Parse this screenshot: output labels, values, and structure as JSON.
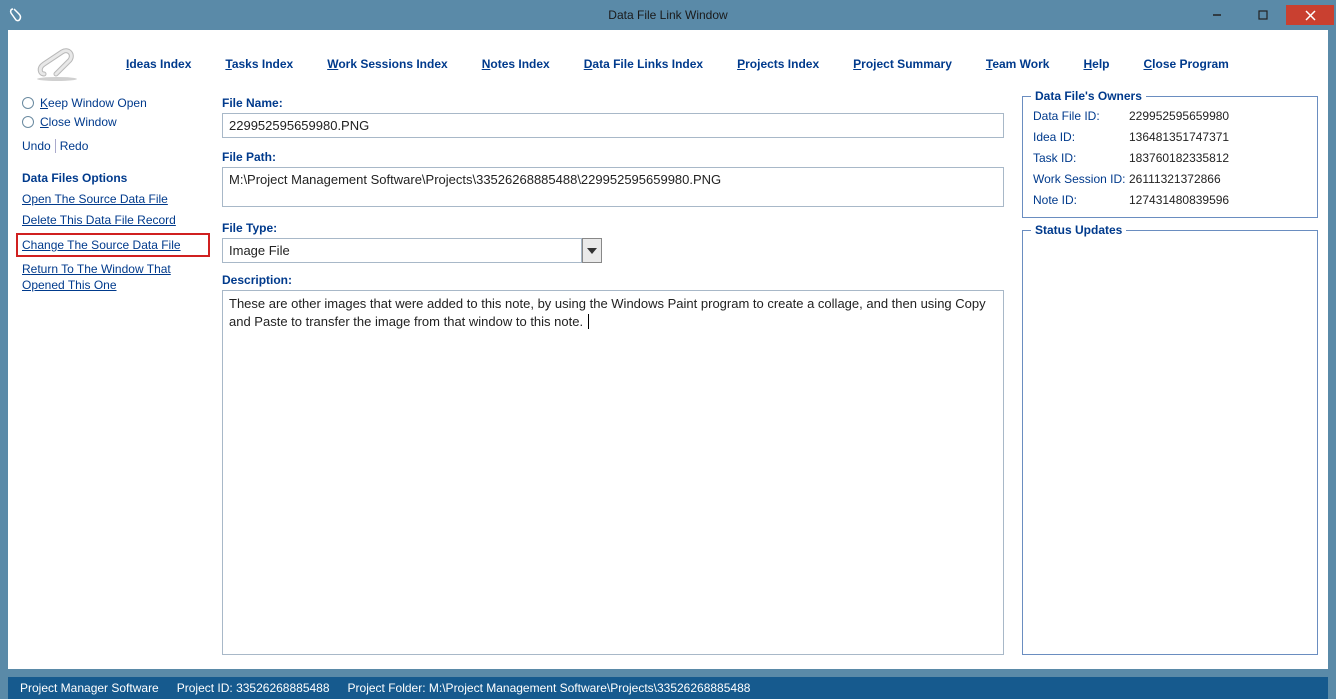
{
  "window": {
    "title": "Data File Link Window"
  },
  "menu": {
    "ideas": "deas Index",
    "tasks": "asks Index",
    "work": "ork Sessions Index",
    "notes": "otes Index",
    "links": "ata File Links Index",
    "projects": "rojects Index",
    "summary": "roject Summary",
    "team": "eam Work",
    "help": "elp",
    "close": "lose Program"
  },
  "left": {
    "keep_open": "eep Window Open",
    "close_win": "lose Window",
    "undo": "Undo",
    "redo": "Redo",
    "options_head": "Data Files Options",
    "open_src": "Open The Source Data File",
    "delete_rec": "Delete This Data File Record",
    "change_src_pre": "Change The ",
    "change_src_post": "ource Data File",
    "return_pre": "eturn To The Window That",
    "return_line2": "Opened This One"
  },
  "form": {
    "file_name_label": "File Name:",
    "file_name": "229952595659980.PNG",
    "file_path_label": "File Path:",
    "file_path": "M:\\Project Management Software\\Projects\\33526268885488\\229952595659980.PNG",
    "file_type_label": "File Type:",
    "file_type": "Image File",
    "desc_label": "Description:",
    "desc": "These are other images that were added to this note, by using the Windows Paint program to create a collage, and then using Copy and Paste to transfer the image from that window to this note."
  },
  "owners": {
    "legend": "Data File's Owners",
    "data_file_id_k": "Data File ID:",
    "data_file_id_v": "229952595659980",
    "idea_id_k": "Idea ID:",
    "idea_id_v": "136481351747371",
    "task_id_k": "Task ID:",
    "task_id_v": "183760182335812",
    "ws_id_k": "Work Session ID:",
    "ws_id_v": "26111321372866",
    "note_id_k": "Note ID:",
    "note_id_v": "127431480839596"
  },
  "status_panel": {
    "legend": "Status Updates"
  },
  "statusbar": {
    "app": "Project Manager Software",
    "proj_id": "Project ID:  33526268885488",
    "proj_folder": "Project Folder:  M:\\Project Management Software\\Projects\\33526268885488"
  }
}
